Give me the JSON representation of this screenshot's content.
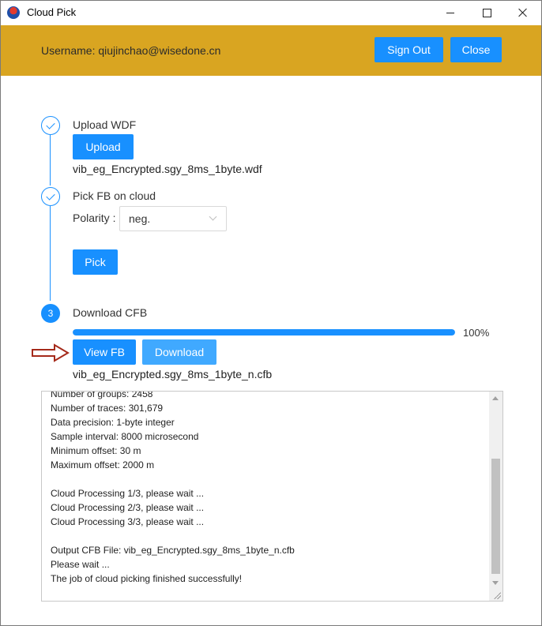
{
  "window": {
    "title": "Cloud Pick"
  },
  "header": {
    "username_text": "Username: qiujinchao@wisedone.cn",
    "sign_out_label": "Sign Out",
    "close_label": "Close"
  },
  "steps": [
    {
      "title": "Upload WDF",
      "button_label": "Upload",
      "file": "vib_eg_Encrypted.sgy_8ms_1byte.wdf",
      "status": "done"
    },
    {
      "title": "Pick FB on cloud",
      "polarity_label": "Polarity :",
      "polarity_value": "neg.",
      "button_label": "Pick",
      "status": "done"
    },
    {
      "number": "3",
      "title": "Download CFB",
      "progress_text": "100%",
      "progress_percent": 100,
      "view_button_label": "View FB",
      "download_button_label": "Download",
      "file": "vib_eg_Encrypted.sgy_8ms_1byte_n.cfb",
      "status": "active"
    }
  ],
  "log": {
    "lines": [
      "Number of groups: 2458",
      "Number of traces: 301,679",
      "Data precision: 1-byte integer",
      "Sample interval: 8000 microsecond",
      "Minimum offset: 30 m",
      "Maximum offset: 2000 m",
      "",
      "Cloud Processing 1/3, please wait ...",
      "Cloud Processing 2/3, please wait ...",
      "Cloud Processing 3/3, please wait ...",
      "",
      "Output CFB File: vib_eg_Encrypted.sgy_8ms_1byte_n.cfb",
      "Please wait ...",
      "The job of cloud picking finished successfully!"
    ]
  },
  "colors": {
    "header_bg": "#d9a521",
    "primary": "#1890ff",
    "arrow": "#a52a1a"
  },
  "icons": [
    "app-icon",
    "minimize-icon",
    "maximize-icon",
    "close-icon",
    "check-icon",
    "chevron-down-icon",
    "arrow-right-icon"
  ]
}
